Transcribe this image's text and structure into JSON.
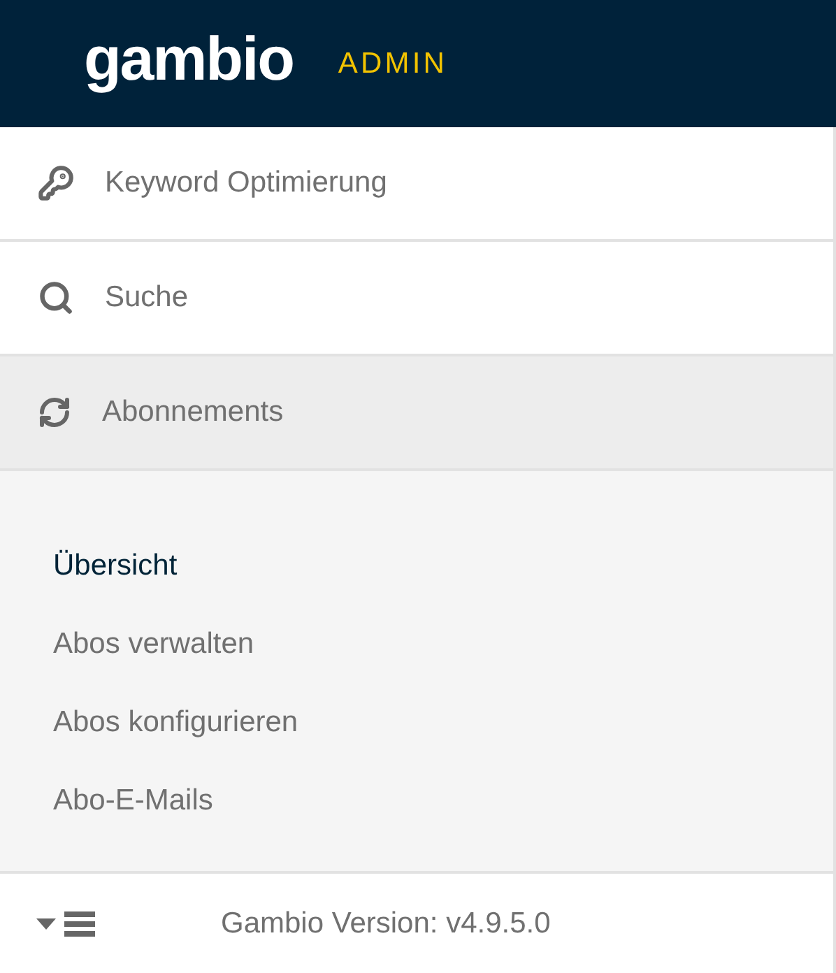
{
  "header": {
    "logo": "gambio",
    "badge": "ADMIN"
  },
  "menu": [
    {
      "kind": "key",
      "label": "Keyword Optimierung",
      "expanded": false
    },
    {
      "kind": "search",
      "label": "Suche",
      "expanded": false
    },
    {
      "kind": "refresh",
      "label": "Abonnements",
      "expanded": true,
      "children": [
        {
          "label": "Übersicht",
          "selected": true
        },
        {
          "label": "Abos verwalten",
          "selected": false
        },
        {
          "label": "Abos konfigurieren",
          "selected": false
        },
        {
          "label": "Abo-E-Mails",
          "selected": false
        }
      ]
    }
  ],
  "footer": {
    "version": "Gambio Version: v4.9.5.0"
  }
}
